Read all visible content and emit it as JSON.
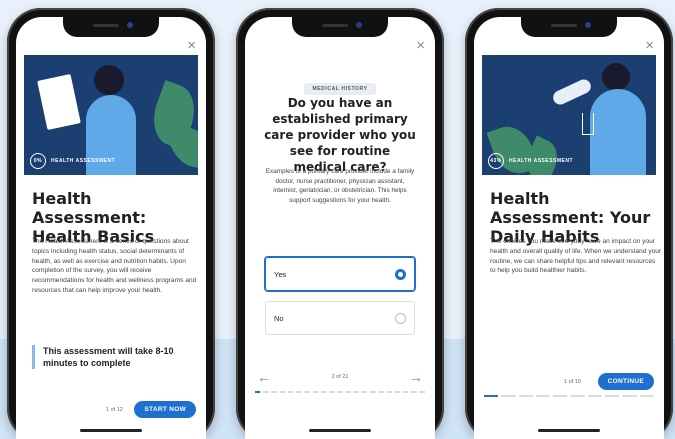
{
  "screen1": {
    "badge_pct": "0%",
    "badge_label": "HEALTH ASSESSMENT",
    "title": "Health Assessment: Health Basics",
    "body": "The Health Assessment is a series of questions about topics including health status, social determinants of health, as well as exercise and nutrition habits. Upon completion of the survey, you will receive recommendations for health and wellness programs and resources that can help improve your health.",
    "note": "This assessment will take 8-10 minutes to complete",
    "pager": "1 of 12",
    "button": "START NOW"
  },
  "screen2": {
    "tag": "MEDICAL HISTORY",
    "question": "Do you have an established primary care provider who you see for routine medical care?",
    "body": "Examples of a primary care provider include a family doctor, nurse practitioner, physician assistant, internist, geriatrician, or obstetrician. This helps support suggestions for your health.",
    "options": [
      {
        "label": "Yes",
        "selected": true
      },
      {
        "label": "No",
        "selected": false
      }
    ],
    "pager": "2 of 21"
  },
  "screen3": {
    "badge_pct": "43%",
    "badge_label": "HEALTH ASSESSMENT",
    "title": "Health Assessment: Your Daily Habits",
    "body": "The choices you make everyday have an impact on your health and overall quality of life. When we understand your routine, we can share helpful tips and relevant resources to help you build healthier habits.",
    "pager": "1 of 10",
    "button": "CONTINUE"
  },
  "close_glyph": "×",
  "colors": {
    "accent": "#1f6fd1",
    "hero": "#1b3f70",
    "leaf": "#3e8a6a"
  }
}
